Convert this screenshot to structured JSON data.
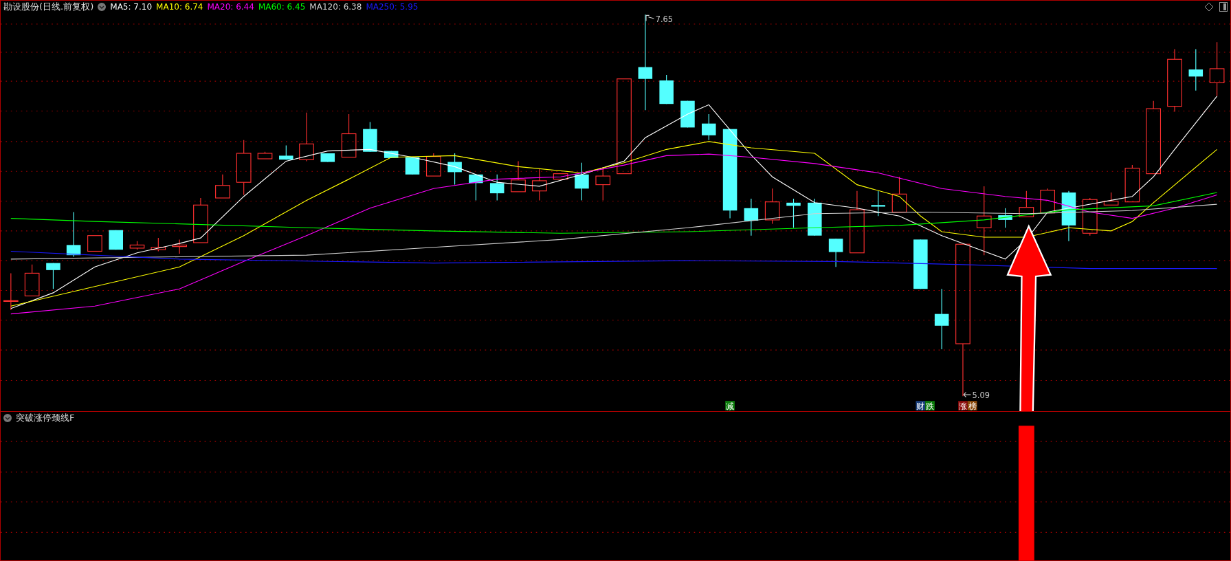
{
  "title": "勘设股份(日线.前复权)",
  "ma_legend": [
    {
      "text": "MA5: 7.10",
      "color": "#ffffff"
    },
    {
      "text": "MA10: 6.74",
      "color": "#ffff00"
    },
    {
      "text": "MA20: 6.44",
      "color": "#ff00ff"
    },
    {
      "text": "MA60: 6.45",
      "color": "#00ff00"
    },
    {
      "text": "MA120: 6.38",
      "color": "#d0d0d0"
    },
    {
      "text": "MA250: 5.95",
      "color": "#1a1aff"
    }
  ],
  "price_labels": {
    "high": "7.65",
    "low": "5.09"
  },
  "event_markers": [
    [
      {
        "text": "减",
        "color": "#0b7d0b"
      }
    ],
    [
      {
        "text": "财",
        "color": "#1a3e7a"
      },
      {
        "text": "跌",
        "color": "#0b7d0b"
      }
    ],
    [
      {
        "text": "涨",
        "color": "#8b0a0a"
      },
      {
        "text": "榜",
        "color": "#8b4a0a"
      }
    ]
  ],
  "indicator_panel": {
    "title": "突破涨停颈线F"
  }
}
